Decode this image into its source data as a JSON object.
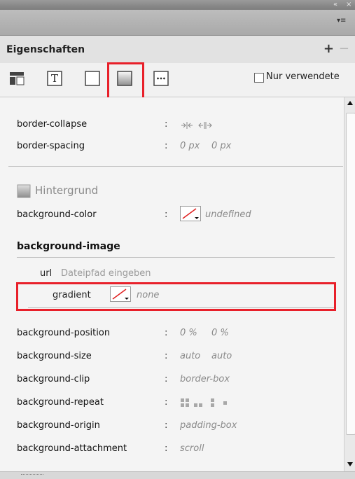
{
  "window": {
    "collapse_glyph": "«",
    "close_glyph": "×",
    "menu_glyph": "▾≡"
  },
  "panel": {
    "title": "Eigenschaften",
    "add_label": "+",
    "remove_label": "−"
  },
  "toolbar": {
    "only_used_label": "Nur verwendete",
    "tools": [
      "layout-icon",
      "text-icon",
      "border-icon",
      "background-icon",
      "more-icon"
    ],
    "active_tool": "background-icon"
  },
  "table_section": {
    "rows": [
      {
        "name": "border-collapse",
        "value": "→|← ←||→"
      },
      {
        "name": "border-spacing",
        "value_1": "0 px",
        "value_2": "0 px"
      }
    ]
  },
  "background_section": {
    "title": "Hintergrund",
    "background_color": {
      "name": "background-color",
      "value": "undefined"
    },
    "background_image": {
      "title": "background-image",
      "url_label": "url",
      "url_placeholder": "Dateipfad eingeben",
      "gradient_label": "gradient",
      "gradient_value": "none"
    },
    "rows": [
      {
        "name": "background-position",
        "value_1": "0 %",
        "value_2": "0 %"
      },
      {
        "name": "background-size",
        "value_1": "auto",
        "value_2": "auto"
      },
      {
        "name": "background-clip",
        "value_1": "border-box"
      },
      {
        "name": "background-repeat",
        "value_1": ""
      },
      {
        "name": "background-origin",
        "value_1": "padding-box"
      },
      {
        "name": "background-attachment",
        "value_1": "scroll"
      }
    ]
  },
  "colors": {
    "highlight": "#e8202a",
    "header_bg": "#e2e2e2"
  }
}
